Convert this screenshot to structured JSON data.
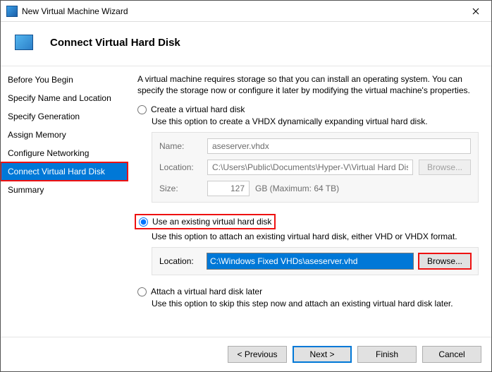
{
  "window": {
    "title": "New Virtual Machine Wizard"
  },
  "header": {
    "title": "Connect Virtual Hard Disk"
  },
  "sidebar": {
    "steps": [
      "Before You Begin",
      "Specify Name and Location",
      "Specify Generation",
      "Assign Memory",
      "Configure Networking",
      "Connect Virtual Hard Disk",
      "Summary"
    ],
    "active_index": 5
  },
  "content": {
    "intro": "A virtual machine requires storage so that you can install an operating system. You can specify the storage now or configure it later by modifying the virtual machine's properties.",
    "opt_create": {
      "label": "Create a virtual hard disk",
      "desc": "Use this option to create a VHDX dynamically expanding virtual hard disk.",
      "name_label": "Name:",
      "name_value": "aseserver.vhdx",
      "loc_label": "Location:",
      "loc_value": "C:\\Users\\Public\\Documents\\Hyper-V\\Virtual Hard Disks\\",
      "browse": "Browse...",
      "size_label": "Size:",
      "size_value": "127",
      "size_unit": "GB (Maximum: 64 TB)"
    },
    "opt_existing": {
      "label": "Use an existing virtual hard disk",
      "desc": "Use this option to attach an existing virtual hard disk, either VHD or VHDX format.",
      "loc_label": "Location:",
      "loc_value": "C:\\Windows Fixed VHDs\\aseserver.vhd",
      "browse": "Browse..."
    },
    "opt_later": {
      "label": "Attach a virtual hard disk later",
      "desc": "Use this option to skip this step now and attach an existing virtual hard disk later."
    }
  },
  "footer": {
    "previous": "< Previous",
    "next": "Next >",
    "finish": "Finish",
    "cancel": "Cancel"
  }
}
